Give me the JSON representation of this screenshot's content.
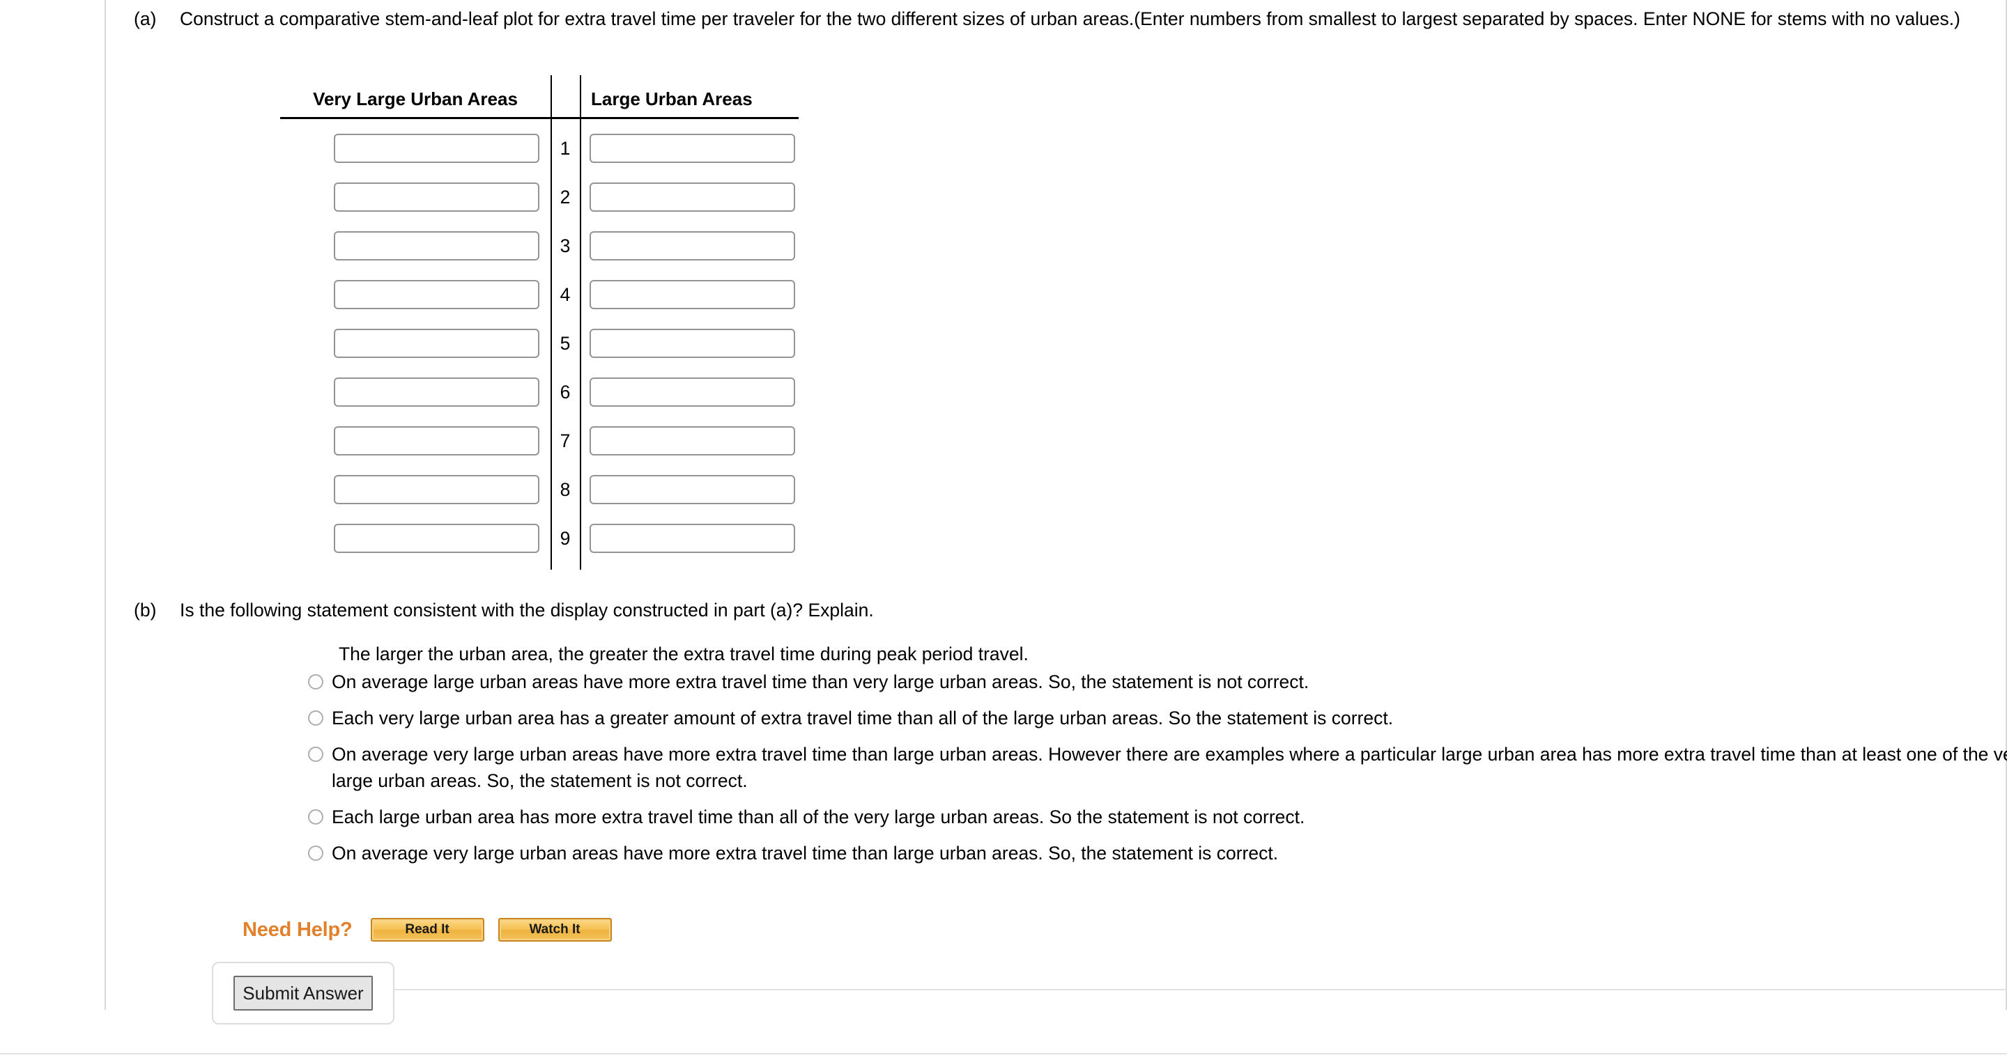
{
  "parts": {
    "a": {
      "label": "(a)",
      "text": "Construct a comparative stem-and-leaf plot for extra travel time per traveler for the two different sizes of urban areas.(Enter numbers from smallest to largest separated by spaces. Enter NONE for stems with no values.)"
    },
    "b": {
      "label": "(b)",
      "text": "Is the following statement consistent with the display constructed in part (a)? Explain.",
      "statement": "The larger the urban area, the greater the extra travel time during peak period travel."
    }
  },
  "stemleaf": {
    "header_left": "Very Large Urban Areas",
    "header_right": "Large Urban Areas",
    "rows": [
      {
        "stem": "1",
        "left_value": "",
        "right_value": ""
      },
      {
        "stem": "2",
        "left_value": "",
        "right_value": ""
      },
      {
        "stem": "3",
        "left_value": "",
        "right_value": ""
      },
      {
        "stem": "4",
        "left_value": "",
        "right_value": ""
      },
      {
        "stem": "5",
        "left_value": "",
        "right_value": ""
      },
      {
        "stem": "6",
        "left_value": "",
        "right_value": ""
      },
      {
        "stem": "7",
        "left_value": "",
        "right_value": ""
      },
      {
        "stem": "8",
        "left_value": "",
        "right_value": ""
      },
      {
        "stem": "9",
        "left_value": "",
        "right_value": ""
      }
    ]
  },
  "options": [
    {
      "text": "On average large urban areas have more extra travel time than very large urban areas. So, the statement is not correct.",
      "selected": false
    },
    {
      "text": "Each very large urban area has a greater amount of extra travel time than all of the large urban areas. So the statement is correct.",
      "selected": false
    },
    {
      "text": "On average very large urban areas have more extra travel time than large urban areas. However there are examples where a particular large urban area has more extra travel time than at least one of the very large urban areas. So, the statement is not correct.",
      "selected": false
    },
    {
      "text": "Each large urban area has more extra travel time than all of the very large urban areas. So the statement is not correct.",
      "selected": false
    },
    {
      "text": "On average very large urban areas have more extra travel time than large urban areas. So, the statement is correct.",
      "selected": false
    }
  ],
  "help": {
    "label": "Need Help?",
    "read_it": "Read It",
    "watch_it": "Watch It",
    "accent_color": "#e2802c"
  },
  "submit": {
    "label": "Submit Answer"
  }
}
